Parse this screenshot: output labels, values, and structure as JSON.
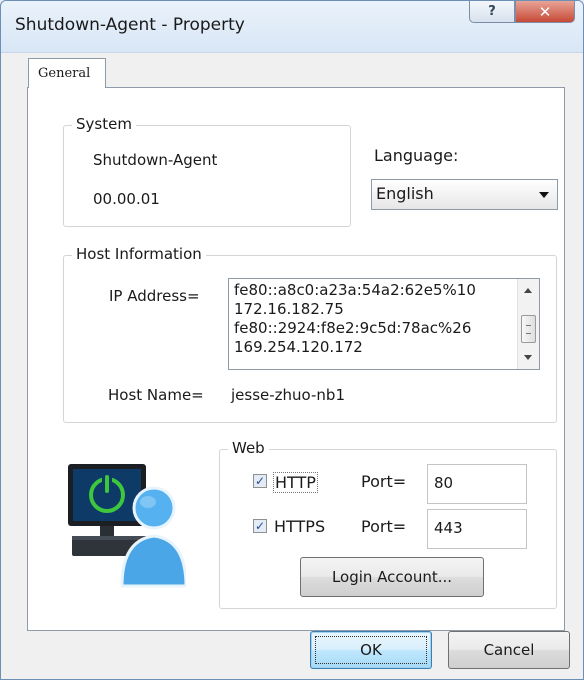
{
  "window": {
    "title": "Shutdown-Agent - Property",
    "help_label": "?",
    "close_label": "✕"
  },
  "tabs": [
    {
      "label": "General",
      "selected": true
    }
  ],
  "system": {
    "legend": "System",
    "app_name": "Shutdown-Agent",
    "version": "00.00.01"
  },
  "language": {
    "label": "Language:",
    "selected": "English"
  },
  "host": {
    "legend": "Host Information",
    "ip_label": "IP Address=",
    "ip_addresses": [
      "fe80::a8c0:a23a:54a2:62e5%10",
      "172.16.182.75",
      "fe80::2924:f8e2:9c5d:78ac%26",
      "169.254.120.172"
    ],
    "hostname_label": "Host Name=",
    "hostname": "jesse-zhuo-nb1"
  },
  "web": {
    "legend": "Web",
    "http": {
      "label": "HTTP",
      "checked": true,
      "port_label": "Port=",
      "port": "80"
    },
    "https": {
      "label": "HTTPS",
      "checked": true,
      "port_label": "Port=",
      "port": "443"
    },
    "login_button": "Login Account..."
  },
  "footer": {
    "ok_label": "OK",
    "cancel_label": "Cancel"
  },
  "colors": {
    "titlebar": "#dbe8f6",
    "close_button": "#c74a37",
    "monitor_screen": "#0d3a66",
    "power_icon": "#3ec63e",
    "user_icon": "#4aa6e6"
  },
  "icons": {
    "illustration": "computer-with-user-icon",
    "power": "power-icon"
  }
}
